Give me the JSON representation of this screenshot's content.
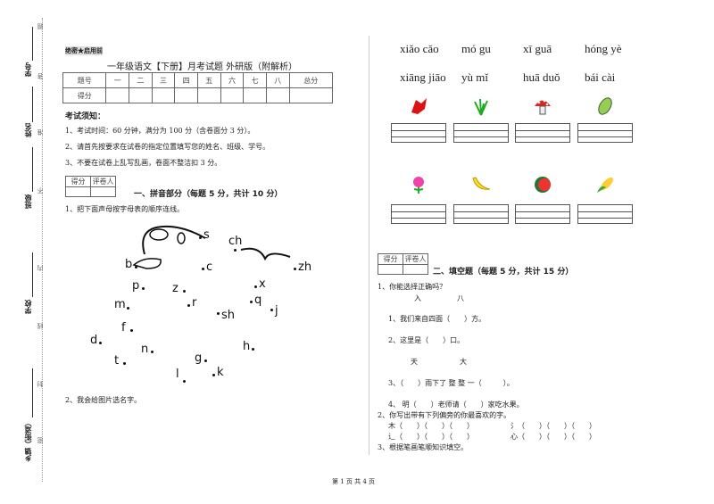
{
  "header": {
    "watermark": "绝密★启用前",
    "title": "一年级语文【下册】月考试题 外研版（附解析）"
  },
  "score_table": {
    "row1": [
      "题号",
      "一",
      "二",
      "三",
      "四",
      "五",
      "六",
      "七",
      "八",
      "总分"
    ],
    "row2_label": "得分"
  },
  "notice": {
    "heading": "考试须知：",
    "items": [
      "1、考试时间：60 分钟，满分为 100 分（含卷面分 3 分）。",
      "2、请首先按要求在试卷的指定位置填写您的姓名、班级、学号。",
      "3、不要在试卷上乱写乱画，卷面不整洁扣 3 分。"
    ]
  },
  "grader": {
    "score": "得分",
    "reviewer": "评卷人"
  },
  "section1": {
    "title": "一、拼音部分（每题 5 分，共计 10 分）",
    "q1": "1、把下面声母按字母表的顺序连线。",
    "q2": "2、我会给图片选名字。",
    "letters": [
      "s",
      "ch",
      "zh",
      "b",
      "c",
      "p",
      "z",
      "x",
      "m",
      "r",
      "q",
      "j",
      "sh",
      "f",
      "d",
      "h",
      "n",
      "t",
      "g",
      "l",
      "k"
    ]
  },
  "pictures": {
    "pinyin_row1": [
      "xiǎo cǎo",
      "mó  gu",
      "xī  guā",
      "hóng yè"
    ],
    "pinyin_row2": [
      "xiāng jiāo",
      "yù  mǐ",
      "huā  duǒ",
      "bái cài"
    ],
    "row1_icons": [
      "red-leaf-icon",
      "grass-icon",
      "mushroom-icon",
      "cabbage-icon"
    ],
    "row2_icons": [
      "flower-icon",
      "banana-icon",
      "watermelon-icon",
      "corn-icon"
    ]
  },
  "section2": {
    "title": "二、填空题（每题 5 分，共计 15 分）",
    "q1": "1、你能选择正确吗？",
    "pair1": [
      "入",
      "八"
    ],
    "s1": "1、我们来自四面（　　）方。",
    "s2": "2、这里是（　　）口。",
    "pair2": [
      "天",
      "大"
    ],
    "s3": "3、（　　）雨下了 整 整 一（　　　）。",
    "s4": "4、 明（　　）老师请（　　）家吃水果。",
    "q2": "2、你写出带有下列偏旁的你最喜欢的字。",
    "radicals": [
      {
        "r": "木",
        "b": "（　　）（　　）（　　）"
      },
      {
        "r": "氵",
        "b": "（　　）（　　）（　　）"
      },
      {
        "r": "辶",
        "b": "（　　）（　　）（　　）"
      },
      {
        "r": "心",
        "b": "（　　）（　　）（　　）"
      }
    ],
    "q3": "3、根据笔画笔顺知识填空。"
  },
  "margin": {
    "labels": [
      "学号",
      "姓名",
      "班级",
      "学校",
      "乡镇（街道）"
    ],
    "seal": [
      "题",
      "答",
      "准",
      "不",
      "内",
      "线",
      "封",
      "密"
    ]
  },
  "footer": "第 1 页 共 4 页"
}
